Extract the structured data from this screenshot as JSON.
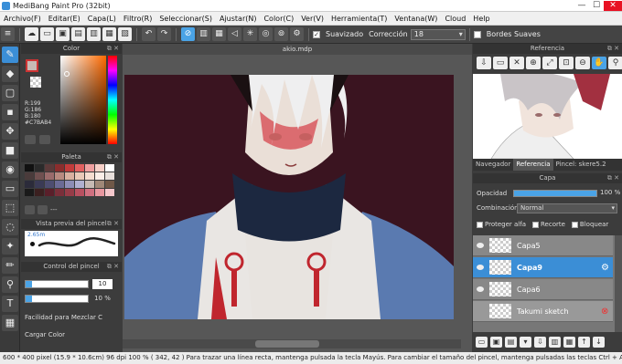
{
  "window": {
    "title": "MediBang Paint Pro (32bit)",
    "min_glyph": "—",
    "max_glyph": "☐",
    "close_glyph": "✕"
  },
  "menu": [
    "Archivo(F)",
    "Editar(E)",
    "Capa(L)",
    "Filtro(R)",
    "Seleccionar(S)",
    "Ajustar(N)",
    "Color(C)",
    "Ver(V)",
    "Herramienta(T)",
    "Ventana(W)",
    "Cloud",
    "Help"
  ],
  "toolbar": {
    "antialias_label": "Suavizado",
    "correction_label": "Corrección",
    "correction_value": "18",
    "soft_edges_label": "Bordes Suaves"
  },
  "color_panel": {
    "title": "Color",
    "foreground": "#C7BAB4",
    "rgb_lines": [
      "R:199",
      "G:186",
      "B:180",
      "#C7BAB4"
    ]
  },
  "palette_panel": {
    "title": "Paleta",
    "empty_label": "---",
    "colors": [
      "#111111",
      "#2a2a2a",
      "#5b3a3a",
      "#8b2d2d",
      "#c23b3b",
      "#e26060",
      "#f0a0a0",
      "#f7d0c8",
      "#ffffff",
      "#4a3b3b",
      "#6f5050",
      "#9a6b6b",
      "#b88a80",
      "#d9b0a0",
      "#e9c9b8",
      "#f5ddd0",
      "#fbeee8",
      "#e8e0dc",
      "#2b2b3a",
      "#3a3a55",
      "#4d4d70",
      "#6b6b95",
      "#8d8db5",
      "#b0b0d0",
      "#c7bab4",
      "#a08878",
      "#705848",
      "#1a1a1a",
      "#3b2020",
      "#5a1f2a",
      "#7a2f3a",
      "#963c48",
      "#b85060",
      "#d07080",
      "#e898a0",
      "#f5c8cc"
    ]
  },
  "brush_preview": {
    "title": "Vista previa del pincel",
    "size_label": "2.65m"
  },
  "brush_control": {
    "title": "Control del pincel",
    "size_value": "10",
    "size_fraction": 0.1,
    "opacity_value": "10 %",
    "opacity_fraction": 0.1,
    "mix_label": "Facilidad para Mezclar C",
    "load_label": "Cargar Color"
  },
  "document": {
    "tab_title": "akio.mdp"
  },
  "reference_panel": {
    "title": "Referencia",
    "tabs": [
      "Navegador",
      "Referencia",
      "Pincel: skere5.2"
    ],
    "active_tab": 1
  },
  "layer_panel": {
    "title": "Capa",
    "opacity_label": "Opacidad",
    "opacity_value": "100 %",
    "blend_label": "Combinación",
    "blend_value": "Normal",
    "protect_alpha_label": "Proteger alfa",
    "clip_label": "Recorte",
    "lock_label": "Bloquear",
    "layers": [
      {
        "name": "Capa5",
        "selected": false
      },
      {
        "name": "Capa9",
        "selected": true
      },
      {
        "name": "Capa6",
        "selected": false
      },
      {
        "name": "Takumi sketch",
        "selected": false
      }
    ]
  },
  "status": {
    "text": "600 * 400 pixel   (15.9 * 10.6cm)   96 dpi   100 %   ( 342, 42 )   Para trazar una línea recta, mantenga pulsada la tecla Mayús. Para cambiar el tamaño del pincel, mantenga pulsadas las teclas Ctrl + A"
  }
}
